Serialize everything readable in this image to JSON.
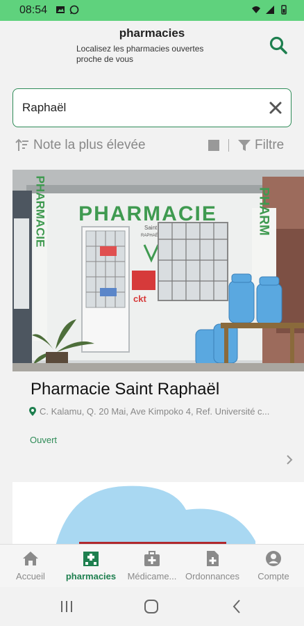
{
  "status_bar": {
    "time": "08:54"
  },
  "header": {
    "title": "pharmacies",
    "subtitle": "Localisez les pharmacies ouvertes proche de vous"
  },
  "search": {
    "value": "Raphaël"
  },
  "sort": {
    "label": "Note la plus élevée"
  },
  "filter": {
    "label": "Filtre"
  },
  "card": {
    "name": "Pharmacie Saint Raphaël",
    "address": "C. Kalamu, Q. 20 Mai, Ave Kimpoko 4, Ref. Université c...",
    "status": "Ouvert",
    "sign_text": "PHARMACIE",
    "side_text": "PHARMACIE",
    "side_text_right": "PHARM",
    "doorsign_1": "Saint",
    "doorsign_2": "RAPHAËL",
    "small_sign": "ckt"
  },
  "nav": {
    "items": [
      {
        "label": "Accueil"
      },
      {
        "label": "pharmacies"
      },
      {
        "label": "Médicame..."
      },
      {
        "label": "Ordonnances"
      },
      {
        "label": "Compte"
      }
    ]
  },
  "colors": {
    "accent": "#1e7f4f",
    "status_bar": "#5fd27d"
  }
}
